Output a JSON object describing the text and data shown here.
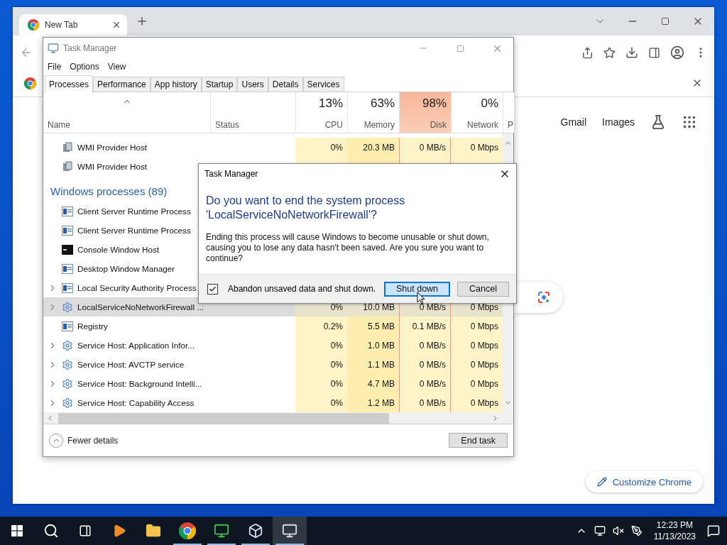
{
  "browser": {
    "tab_title": "New Tab",
    "links": [
      "Gmail",
      "Images"
    ],
    "customize_label": "Customize Chrome"
  },
  "task_manager": {
    "title": "Task Manager",
    "menu": [
      "File",
      "Options",
      "View"
    ],
    "tabs": [
      {
        "label": "Processes",
        "selected": true
      },
      {
        "label": "Performance",
        "selected": false
      },
      {
        "label": "App history",
        "selected": false
      },
      {
        "label": "Startup",
        "selected": false
      },
      {
        "label": "Users",
        "selected": false
      },
      {
        "label": "Details",
        "selected": false
      },
      {
        "label": "Services",
        "selected": false
      }
    ],
    "columns": [
      {
        "label": "Name"
      },
      {
        "label": "Status"
      },
      {
        "label": "CPU",
        "percent": "13%",
        "hot": false
      },
      {
        "label": "Memory",
        "percent": "63%",
        "hot": false
      },
      {
        "label": "Disk",
        "percent": "98%",
        "hot": true
      },
      {
        "label": "Network",
        "percent": "0%",
        "hot": false
      },
      {
        "label": "P"
      }
    ],
    "rows": [
      {
        "kind": "wmi",
        "name": "WMI Provider Host",
        "expandable": false,
        "selected": false,
        "values": [
          "0%",
          "20.3 MB",
          "0 MB/s",
          "0 Mbps"
        ]
      },
      {
        "kind": "wmi",
        "name": "WMI Provider Host",
        "expandable": false,
        "selected": false
      },
      {
        "kind": "group",
        "name": "Windows processes (89)",
        "expandable": false,
        "selected": false
      },
      {
        "kind": "app",
        "name": "Client Server Runtime Process",
        "expandable": false,
        "selected": false
      },
      {
        "kind": "app",
        "name": "Client Server Runtime Process",
        "expandable": false,
        "selected": false
      },
      {
        "kind": "console",
        "name": "Console Window Host",
        "expandable": false,
        "selected": false
      },
      {
        "kind": "app",
        "name": "Desktop Window Manager",
        "expandable": false,
        "selected": false
      },
      {
        "kind": "app",
        "name": "Local Security Authority Process",
        "expandable": true,
        "selected": false
      },
      {
        "kind": "service",
        "name": "LocalServiceNoNetworkFirewall ...",
        "expandable": true,
        "selected": true,
        "values": [
          "0%",
          "10.0 MB",
          "0 MB/s",
          "0 Mbps"
        ]
      },
      {
        "kind": "app",
        "name": "Registry",
        "expandable": false,
        "selected": false,
        "values": [
          "0.2%",
          "5.5 MB",
          "0.1 MB/s",
          "0 Mbps"
        ]
      },
      {
        "kind": "service",
        "name": "Service Host: Application Infor...",
        "expandable": true,
        "selected": false,
        "values": [
          "0%",
          "1.0 MB",
          "0 MB/s",
          "0 Mbps"
        ]
      },
      {
        "kind": "service",
        "name": "Service Host: AVCTP service",
        "expandable": true,
        "selected": false,
        "values": [
          "0%",
          "1.1 MB",
          "0 MB/s",
          "0 Mbps"
        ]
      },
      {
        "kind": "service",
        "name": "Service Host: Background Intelli...",
        "expandable": true,
        "selected": false,
        "values": [
          "0%",
          "4.7 MB",
          "0 MB/s",
          "0 Mbps"
        ]
      },
      {
        "kind": "service",
        "name": "Service Host: Capability Access",
        "expandable": true,
        "selected": false,
        "values": [
          "0%",
          "1.2 MB",
          "0 MB/s",
          "0 Mbps"
        ]
      }
    ],
    "fewer_details": "Fewer details",
    "end_task": "End task"
  },
  "dialog": {
    "title": "Task Manager",
    "heading": "Do you want to end the system process 'LocalServiceNoNetworkFirewall'?",
    "message": "Ending this process will cause Windows to become unusable or shut down, causing you to lose any data hasn't been saved. Are you sure you want to continue?",
    "checkbox": {
      "label": "Abandon unsaved data and shut down.",
      "checked": true
    },
    "buttons": [
      {
        "label": "Shut down",
        "default": true
      },
      {
        "label": "Cancel",
        "default": false
      }
    ]
  },
  "taskbar": {
    "apps": [
      {
        "kind": "media",
        "running": false,
        "active": false
      },
      {
        "kind": "folder",
        "running": false,
        "active": false
      },
      {
        "kind": "chrome",
        "running": true,
        "active": false
      },
      {
        "kind": "monitor",
        "running": true,
        "active": false
      },
      {
        "kind": "cube",
        "running": true,
        "active": false
      },
      {
        "kind": "taskmanager",
        "running": true,
        "active": true
      }
    ],
    "time": "12:23 PM",
    "date": "11/13/2023"
  }
}
